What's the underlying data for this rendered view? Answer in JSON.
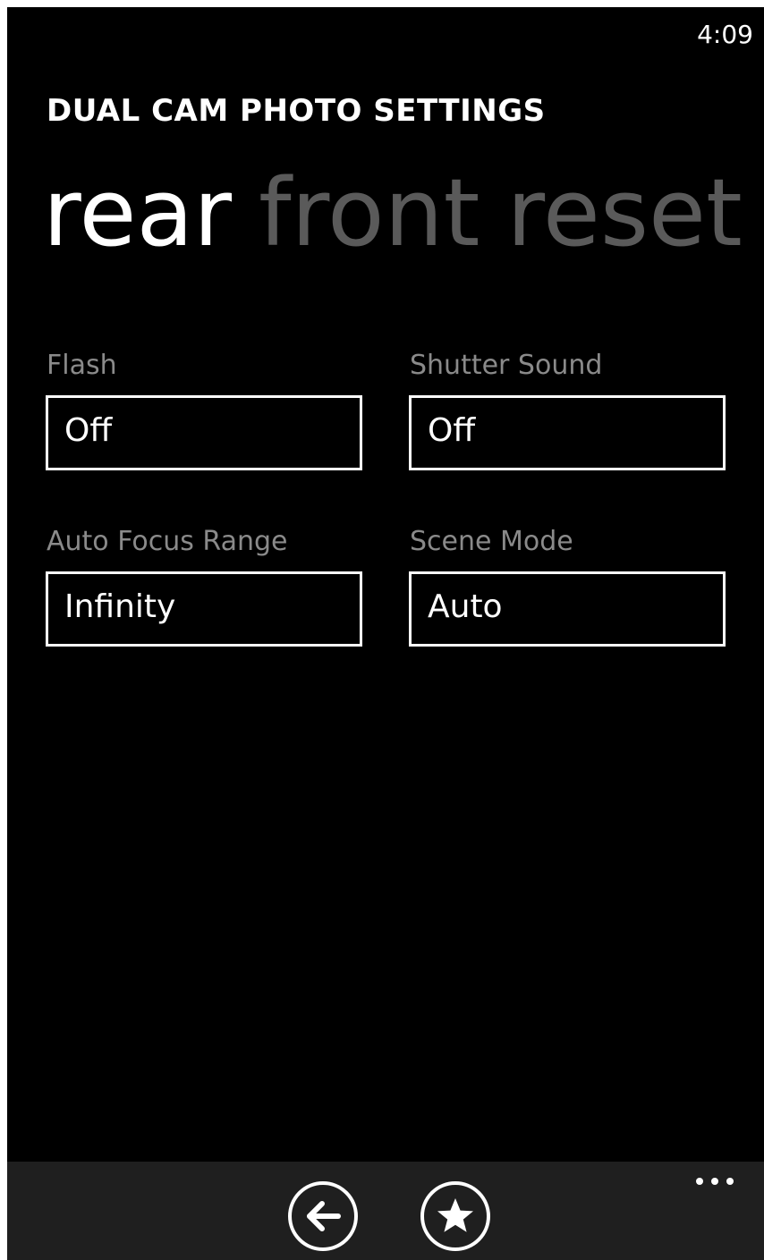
{
  "status_bar": {
    "time": "4:09"
  },
  "header": {
    "app_title": "DUAL CAM PHOTO SETTINGS"
  },
  "pivot": {
    "items": [
      {
        "label": "rear",
        "active": true
      },
      {
        "label": "front",
        "active": false
      },
      {
        "label": "reset",
        "active": false
      }
    ]
  },
  "settings": {
    "flash": {
      "label": "Flash",
      "value": "Off"
    },
    "shutter_sound": {
      "label": "Shutter Sound",
      "value": "Off"
    },
    "auto_focus_range": {
      "label": "Auto Focus Range",
      "value": "Infinity"
    },
    "scene_mode": {
      "label": "Scene Mode",
      "value": "Auto"
    }
  },
  "app_bar": {
    "buttons": [
      {
        "icon": "back-arrow-icon"
      },
      {
        "icon": "star-icon"
      }
    ],
    "more_icon": "ellipsis-icon"
  },
  "colors": {
    "background": "#000000",
    "foreground": "#ffffff",
    "inactive_pivot": "#5a5a5a",
    "label": "#8a8a8a",
    "app_bar": "#1f1f1f"
  }
}
